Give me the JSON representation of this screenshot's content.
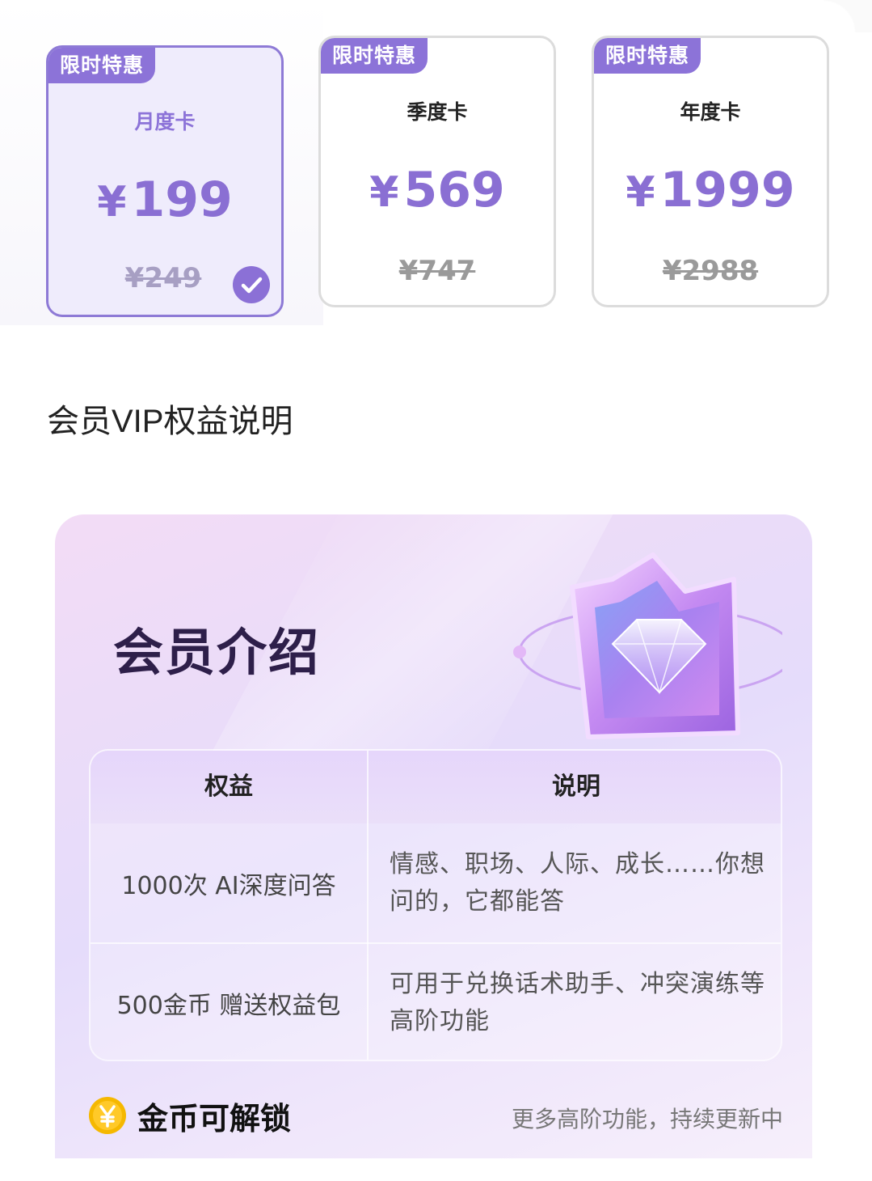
{
  "plans": [
    {
      "badge": "限时特惠",
      "name": "月度卡",
      "currency": "¥",
      "price": "199",
      "original_price": "¥249",
      "selected": true
    },
    {
      "badge": "限时特惠",
      "name": "季度卡",
      "currency": "¥",
      "price": "569",
      "original_price": "¥747",
      "selected": false
    },
    {
      "badge": "限时特惠",
      "name": "年度卡",
      "currency": "¥",
      "price": "1999",
      "original_price": "¥2988",
      "selected": false
    }
  ],
  "section_title": "会员VIP权益说明",
  "benefits": {
    "heading": "会员介绍",
    "table": {
      "headers": [
        "权益",
        "说明"
      ],
      "rows": [
        {
          "benefit": "1000次 AI深度问答",
          "description": "情感、职场、人际、成长……你想问的，它都能答"
        },
        {
          "benefit": "500金币 赠送权益包",
          "description": "可用于兑换话术助手、冲突演练等高阶功能"
        }
      ]
    },
    "footer_title": "金币可解锁",
    "footer_note": "更多高阶功能，持续更新中"
  },
  "colors": {
    "accent": "#8c73d8",
    "selected_bg": "#efecfc",
    "coin": "#f5b800"
  },
  "icons": {
    "check": "check-icon",
    "coin": "coin-yen-icon",
    "crown": "diamond-crown-illustration"
  }
}
